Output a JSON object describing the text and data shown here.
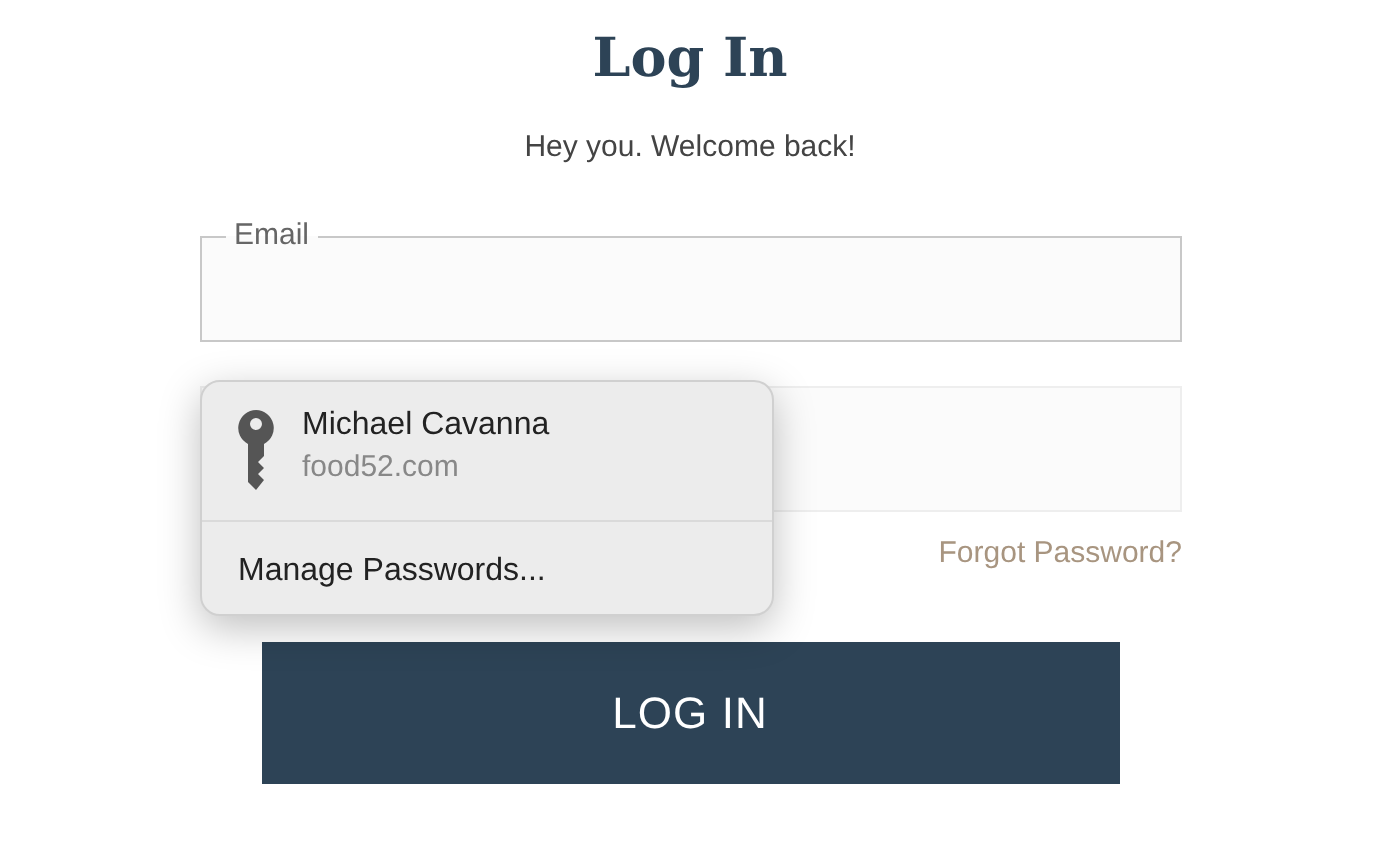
{
  "title": "Log In",
  "subtitle": "Hey you. Welcome back!",
  "email_field": {
    "label": "Email"
  },
  "forgot_link": "Forgot Password?",
  "login_button": "LOG IN",
  "autofill_popup": {
    "account": {
      "name": "Michael Cavanna",
      "site": "food52.com"
    },
    "manage": "Manage Passwords..."
  }
}
